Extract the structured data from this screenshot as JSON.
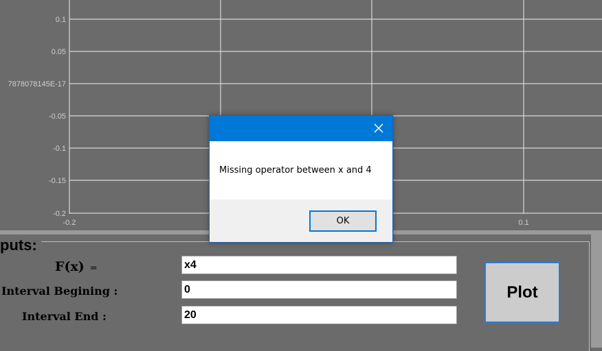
{
  "plot": {
    "y_ticks": [
      "0.1",
      "0.05",
      "7878078145E-17",
      "-0.05",
      "-0.1",
      "-0.15",
      "-0.2"
    ],
    "x_ticks": [
      "-0.2",
      "0.1"
    ],
    "grid_color": "#d8d8d8",
    "background": "#6b6b6b"
  },
  "inputs": {
    "title": "puts:",
    "fx_label": "F(x)",
    "fx_equals": "=",
    "fx_value": "x4",
    "start_label": "Interval Begining :",
    "start_value": "0",
    "end_label": "Interval End :",
    "end_value": "20",
    "plot_button": "Plot"
  },
  "dialog": {
    "message": "Missing operator between x and 4",
    "ok_label": "OK",
    "close_icon": "close-icon",
    "accent": "#0078d7"
  }
}
